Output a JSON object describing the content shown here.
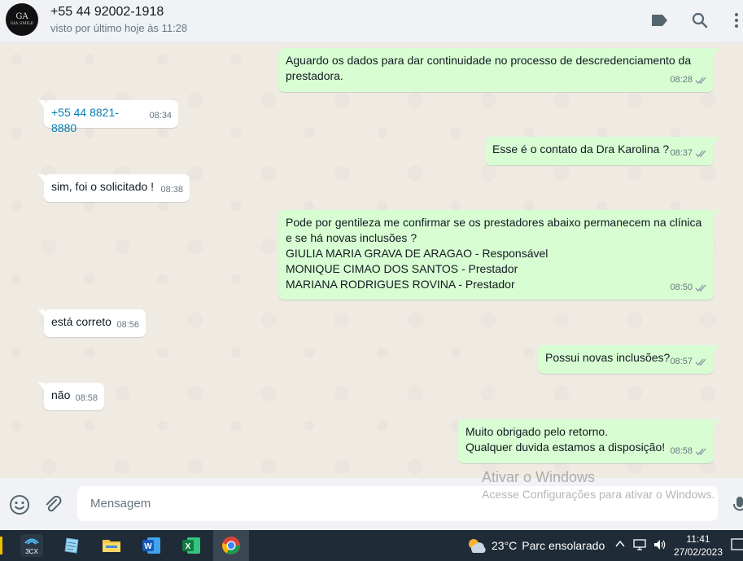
{
  "header": {
    "avatar_mono": "GA",
    "avatar_text": "GIA SMILE",
    "contact_name": "+55 44 92002-1918",
    "status": "visto por último hoje às 11:28",
    "icons": [
      "label-icon",
      "search-icon",
      "menu-icon"
    ]
  },
  "messages": [
    {
      "dir": "out",
      "lines": [
        "Aguardo os dados para dar continuidade no processo de descredenciamento da",
        "prestadora."
      ],
      "time": "08:28"
    },
    {
      "dir": "in",
      "lines": [
        "+55 44 8821-8880"
      ],
      "time": "08:34"
    },
    {
      "dir": "out",
      "lines": [
        "Esse é o contato da Dra Karolina ?"
      ],
      "time": "08:37"
    },
    {
      "dir": "in",
      "lines": [
        "sim, foi o solicitado !"
      ],
      "time": "08:38"
    },
    {
      "dir": "out",
      "lines": [
        "Pode por gentileza me confirmar se os prestadores abaixo permanecem na clínica",
        "e se há novas inclusões ?",
        "GIULIA MARIA GRAVA DE ARAGAO - Responsável",
        "MONIQUE CIMAO DOS SANTOS - Prestador",
        "MARIANA RODRIGUES ROVINA - Prestador"
      ],
      "time": "08:50"
    },
    {
      "dir": "in",
      "lines": [
        "está correto"
      ],
      "time": "08:56"
    },
    {
      "dir": "out",
      "lines": [
        "Possui novas inclusões?"
      ],
      "time": "08:57"
    },
    {
      "dir": "in",
      "lines": [
        "não"
      ],
      "time": "08:58"
    },
    {
      "dir": "out",
      "lines": [
        "Muito obrigado pelo retorno.",
        "Qualquer duvida estamos a disposição!"
      ],
      "time": "08:58"
    }
  ],
  "composer": {
    "placeholder": "Mensagem"
  },
  "watermark": {
    "title": "Ativar o Windows",
    "subtitle": "Acesse Configurações para ativar o Windows."
  },
  "taskbar": {
    "apps": [
      "3CX",
      "notes",
      "file-explorer",
      "word",
      "excel",
      "chrome"
    ],
    "label_3cx": "3CX",
    "weather_temp": "23°C",
    "weather_desc": "Parc ensolarado",
    "time": "11:41",
    "date": "27/02/2023"
  },
  "colors": {
    "outgoing_bubble": "#d9fdd3",
    "incoming_bubble": "#ffffff",
    "link": "#027eb5",
    "tick": "#8696a0"
  }
}
